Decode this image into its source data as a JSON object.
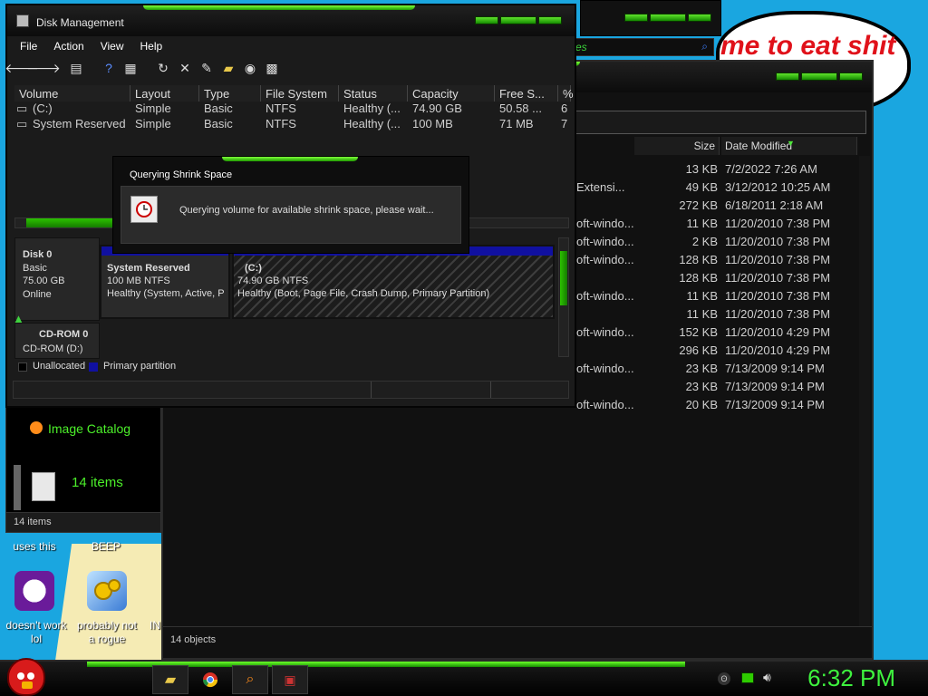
{
  "wallpaper": {
    "bubble_text": "me to eat shit"
  },
  "desktop_icons": [
    {
      "name": "uses this",
      "label": "uses this"
    },
    {
      "name": "beep",
      "label": "BEEP"
    },
    {
      "name": "yahoo",
      "label": "doesn't work\nlol"
    },
    {
      "name": "rogue",
      "label": "probably not\na rogue"
    },
    {
      "name": "partial",
      "label": "IN"
    }
  ],
  "catalog_window": {
    "title": "Image Catalog",
    "items_big": "14 items",
    "status": "14 items"
  },
  "explorer": {
    "search_hint": "es",
    "columns": {
      "size": "Size",
      "modified": "Date Modified"
    },
    "rows": [
      {
        "name": "",
        "size": "13 KB",
        "modified": "7/2/2022 7:26 AM"
      },
      {
        "name": "Extensi...",
        "size": "49 KB",
        "modified": "3/12/2012 10:25 AM"
      },
      {
        "name": "",
        "size": "272 KB",
        "modified": "6/18/2011 2:18 AM"
      },
      {
        "name": "oft-windo...",
        "size": "11 KB",
        "modified": "11/20/2010 7:38 PM"
      },
      {
        "name": "oft-windo...",
        "size": "2 KB",
        "modified": "11/20/2010 7:38 PM"
      },
      {
        "name": "oft-windo...",
        "size": "128 KB",
        "modified": "11/20/2010 7:38 PM"
      },
      {
        "name": "",
        "size": "128 KB",
        "modified": "11/20/2010 7:38 PM"
      },
      {
        "name": "oft-windo...",
        "size": "11 KB",
        "modified": "11/20/2010 7:38 PM"
      },
      {
        "name": "",
        "size": "11 KB",
        "modified": "11/20/2010 7:38 PM"
      },
      {
        "name": "oft-windo...",
        "size": "152 KB",
        "modified": "11/20/2010 4:29 PM"
      },
      {
        "name": "",
        "size": "296 KB",
        "modified": "11/20/2010 4:29 PM"
      },
      {
        "name": "oft-windo...",
        "size": "23 KB",
        "modified": "7/13/2009 9:14 PM"
      },
      {
        "name": "",
        "size": "23 KB",
        "modified": "7/13/2009 9:14 PM"
      },
      {
        "name": "oft-windo...",
        "size": "20 KB",
        "modified": "7/13/2009 9:14 PM"
      }
    ],
    "status": "14 objects"
  },
  "disk_mgmt": {
    "title": "Disk Management",
    "menu": [
      "File",
      "Action",
      "View",
      "Help"
    ],
    "columns": [
      "Volume",
      "Layout",
      "Type",
      "File System",
      "Status",
      "Capacity",
      "Free S...",
      "%"
    ],
    "volumes": [
      {
        "volume": "(C:)",
        "layout": "Simple",
        "type": "Basic",
        "fs": "NTFS",
        "status": "Healthy (...",
        "capacity": "74.90 GB",
        "free": "50.58 ...",
        "pct": "6"
      },
      {
        "volume": "System Reserved",
        "layout": "Simple",
        "type": "Basic",
        "fs": "NTFS",
        "status": "Healthy (...",
        "capacity": "100 MB",
        "free": "71 MB",
        "pct": "7"
      }
    ],
    "disk0": {
      "name": "Disk 0",
      "type": "Basic",
      "size": "75.00 GB",
      "state": "Online"
    },
    "part_sysres": {
      "name": "System Reserved",
      "size": "100 MB NTFS",
      "status": "Healthy (System, Active, P"
    },
    "part_c": {
      "name": "(C:)",
      "size": "74.90 GB NTFS",
      "status": "Healthy (Boot, Page File, Crash Dump, Primary Partition)"
    },
    "cdrom": {
      "name": "CD-ROM 0",
      "drive": "CD-ROM (D:)"
    },
    "legend": {
      "unallocated": "Unallocated",
      "primary": "Primary partition"
    }
  },
  "dialog": {
    "title": "Querying Shrink Space",
    "message": "Querying volume for available shrink space, please wait..."
  },
  "taskbar": {
    "clock": "6:32 PM"
  },
  "colors": {
    "accent": "#2ecc00",
    "desktop": "#1aa6e0",
    "partition_blue": "#1010a0"
  }
}
